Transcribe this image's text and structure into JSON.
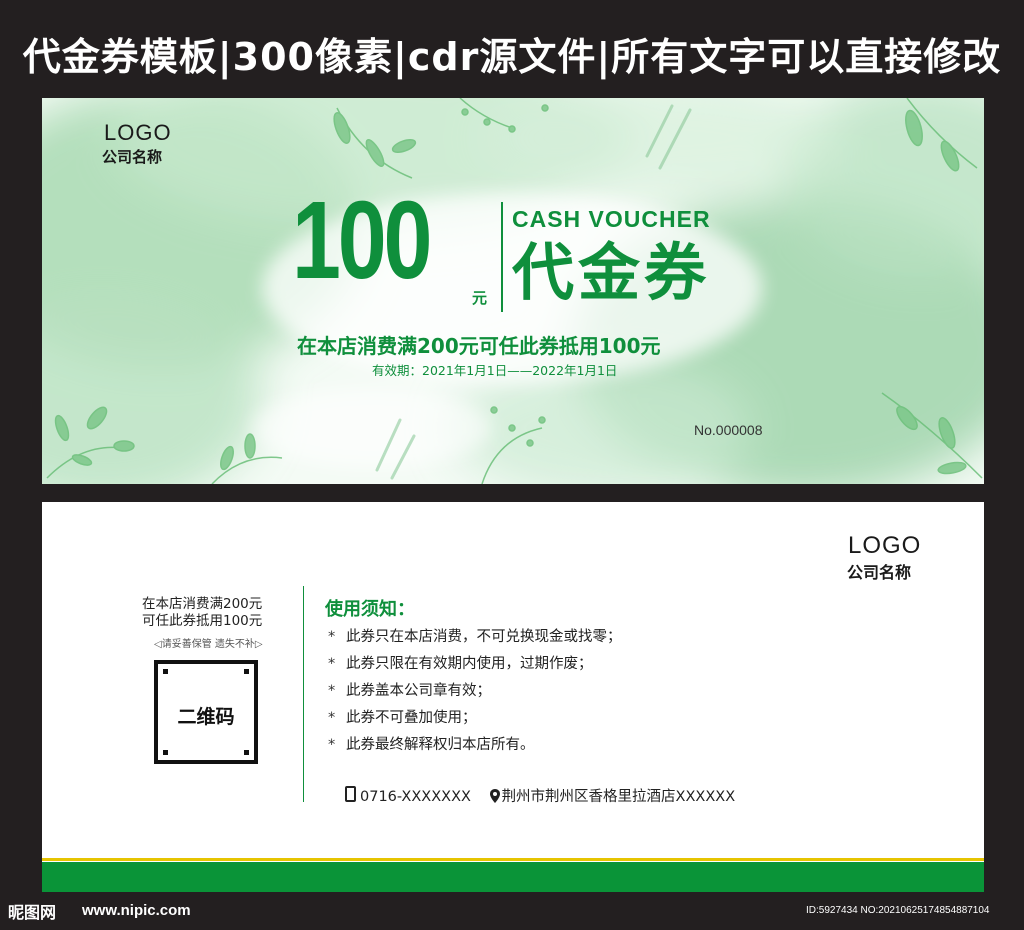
{
  "header": {
    "title": "代金券模板|300像素|cdr源文件|所有文字可以直接修改"
  },
  "front": {
    "logo": "LOGO",
    "company": "公司名称",
    "amount": "100",
    "unit": "元",
    "cash_voucher": "CASH VOUCHER",
    "voucher_cn": "代金券",
    "offer": "在本店消费满200元可任此券抵用100元",
    "validity": "有效期：2021年1月1日——2022年1月1日",
    "serial": "No.000008"
  },
  "back": {
    "logo": "LOGO",
    "company": "公司名称",
    "side_line1": "在本店消费满200元",
    "side_line2": "可任此券抵用100元",
    "keep_note": "◁请妥善保管  遗失不补▷",
    "qr_label": "二维码",
    "rules_title": "使用须知：",
    "rules": [
      "此券只在本店消费，不可兑换现金或找零；",
      "此券只限在有效期内使用，过期作废；",
      "此券盖本公司章有效；",
      "此券不可叠加使用；",
      "此券最终解释权归本店所有。"
    ],
    "phone": "0716-XXXXXXX",
    "address": "荆州市荆州区香格里拉酒店XXXXXX"
  },
  "watermark": {
    "site_name": "昵图网",
    "url": "www.nipic.com",
    "id": "ID:5927434 NO:20210625174854887104"
  },
  "colors": {
    "brand_green": "#0f8f3c",
    "band_green": "#0a9438",
    "accent_yellow": "#e6c400",
    "dark_background": "#231f20"
  }
}
